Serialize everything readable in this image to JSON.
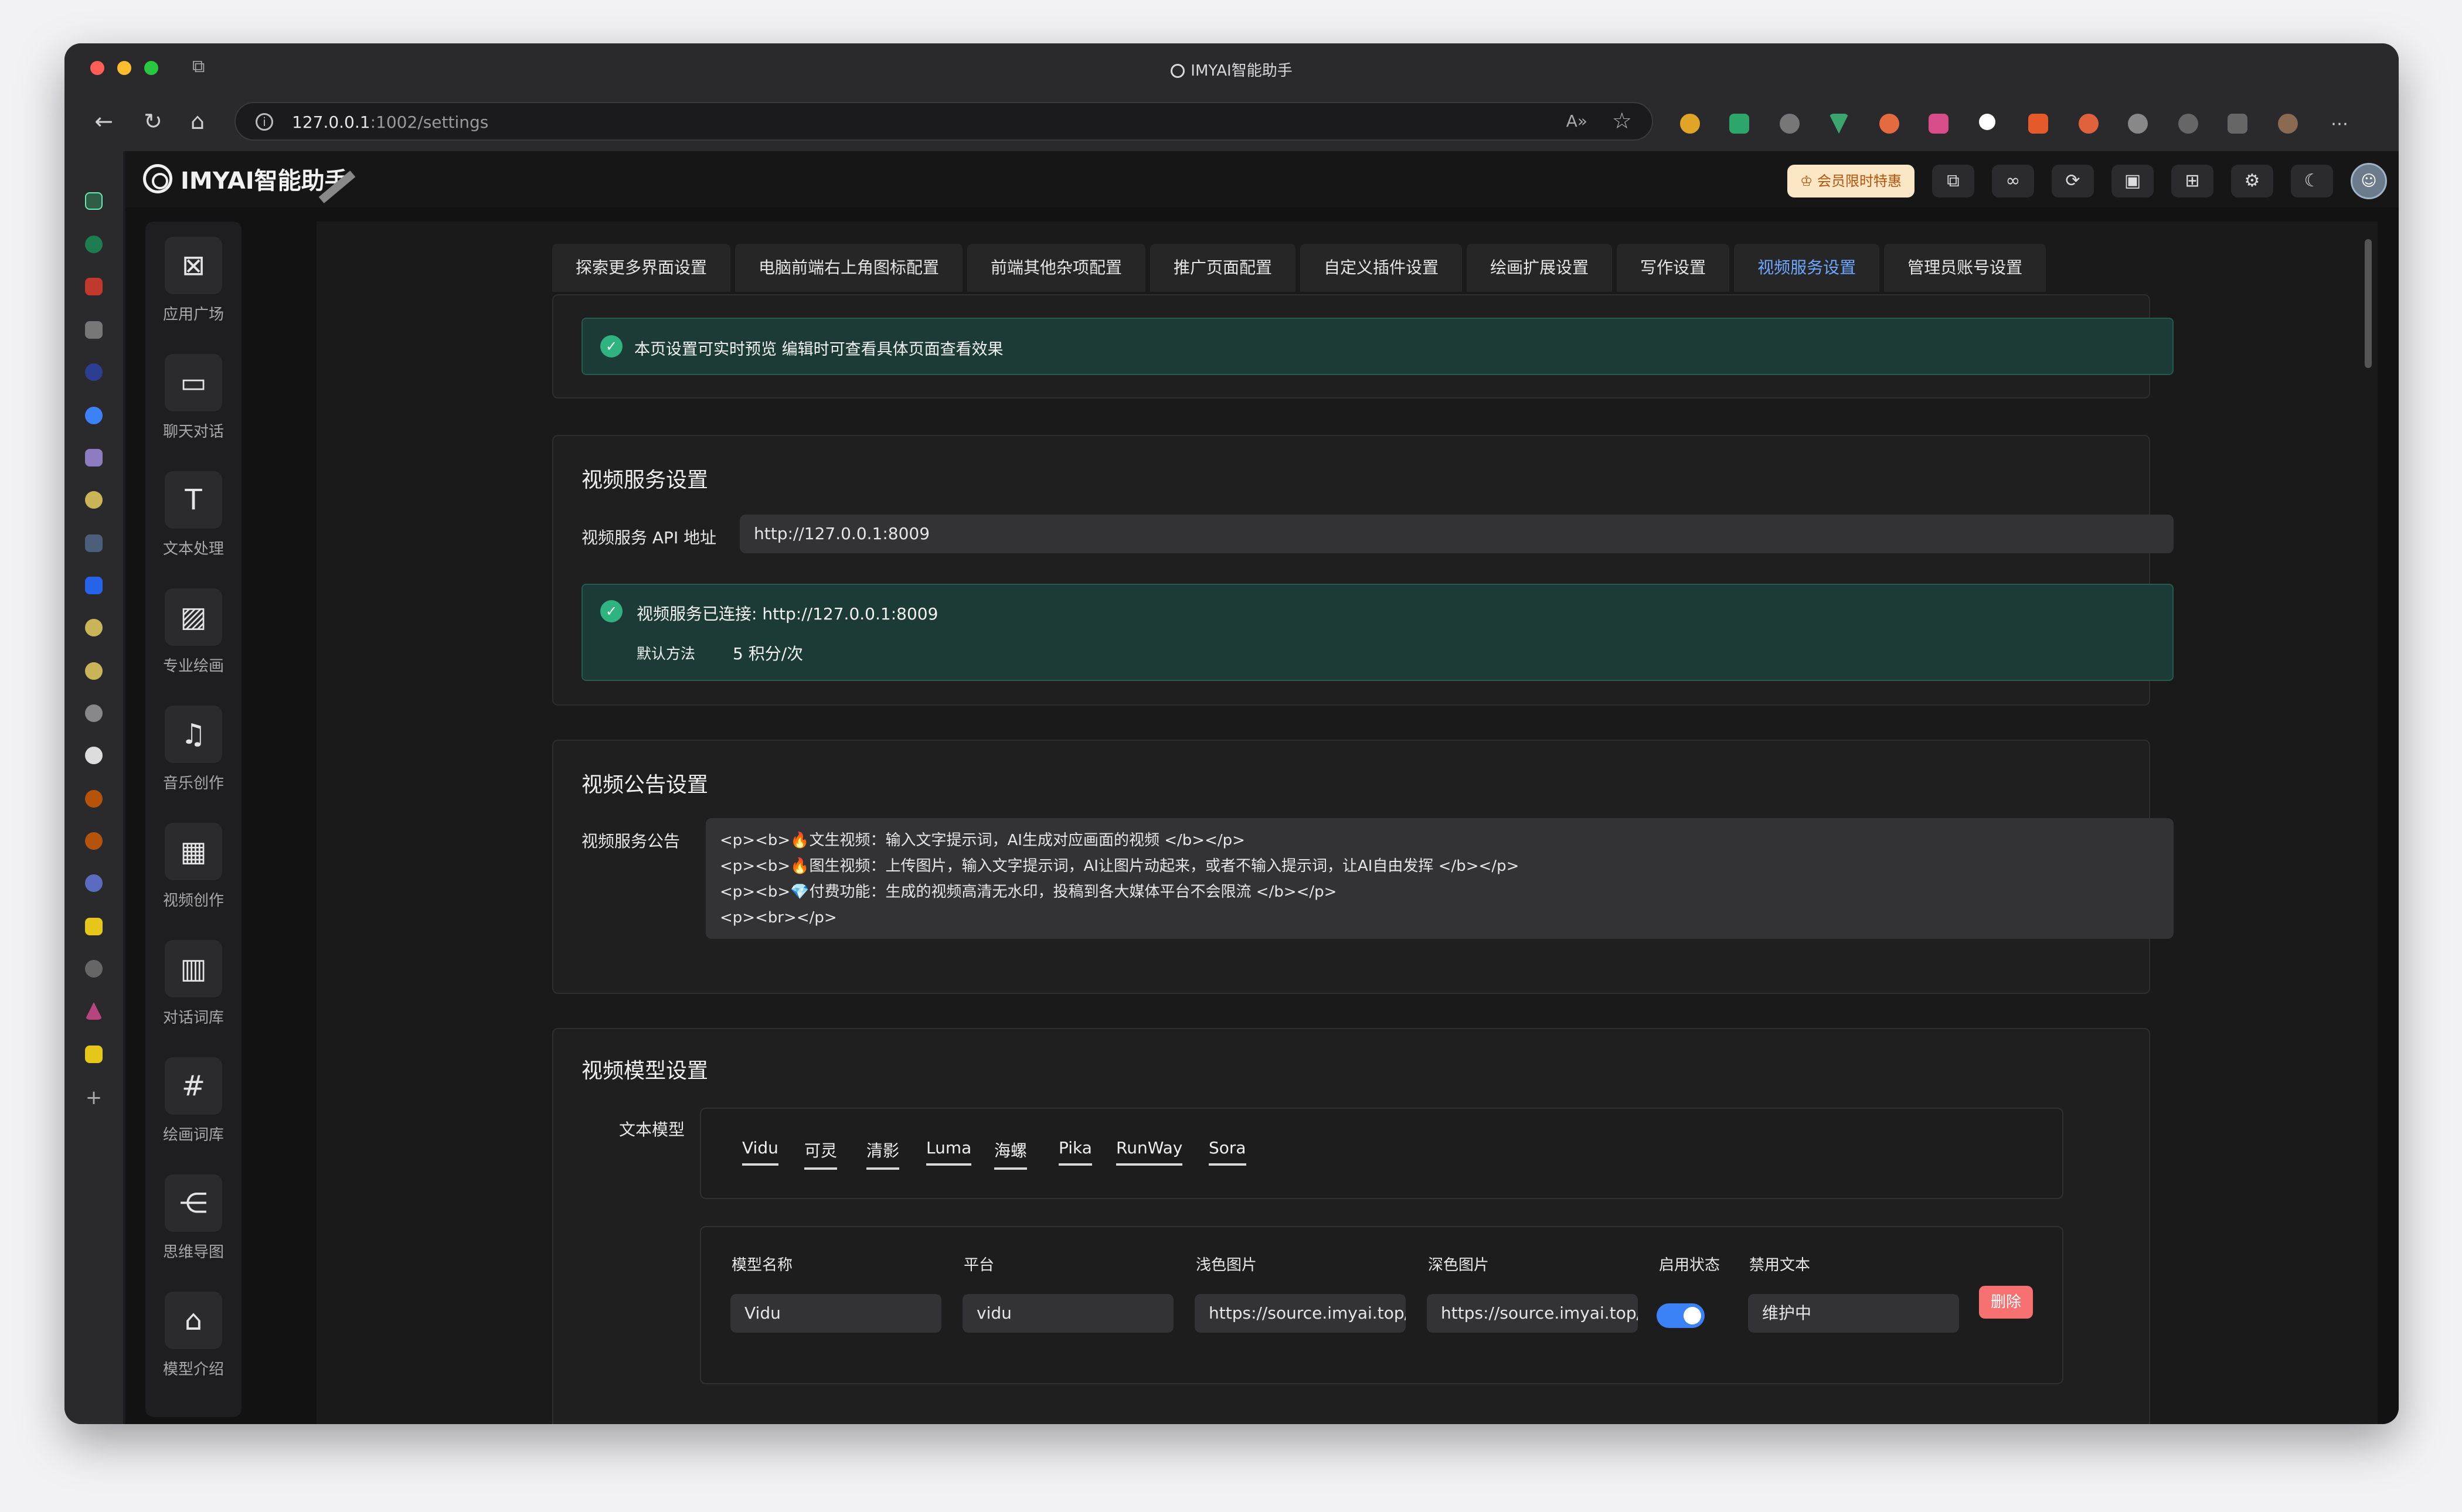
{
  "window": {
    "title": "IMYAI智能助手"
  },
  "browser": {
    "url_host": "127.0.0.1",
    "url_path": ":1002/settings"
  },
  "app": {
    "brand": "IMYAI智能助手",
    "vip_label": "会员限时特惠",
    "nav": [
      {
        "label": "应用广场",
        "icon": "app-store-icon"
      },
      {
        "label": "聊天对话",
        "icon": "chat-icon"
      },
      {
        "label": "文本处理",
        "icon": "text-icon"
      },
      {
        "label": "专业绘画",
        "icon": "image-icon"
      },
      {
        "label": "音乐创作",
        "icon": "music-icon"
      },
      {
        "label": "视频创作",
        "icon": "video-icon"
      },
      {
        "label": "对话词库",
        "icon": "book-icon"
      },
      {
        "label": "绘画词库",
        "icon": "palette-icon"
      },
      {
        "label": "思维导图",
        "icon": "mindmap-icon"
      },
      {
        "label": "模型介绍",
        "icon": "robot-icon"
      }
    ]
  },
  "settings": {
    "tabs": [
      "探索更多界面设置",
      "电脑前端右上角图标配置",
      "前端其他杂项配置",
      "推广页面配置",
      "自定义插件设置",
      "绘画扩展设置",
      "写作设置",
      "视频服务设置",
      "管理员账号设置"
    ],
    "active_tab": 7,
    "notice": "本页设置可实时预览 编辑时可查看具体页面查看效果",
    "service": {
      "title": "视频服务设置",
      "api_label": "视频服务 API 地址",
      "api_value": "http://127.0.0.1:8009",
      "status_text": "视频服务已连接: http://127.0.0.1:8009",
      "method_label": "默认方法",
      "method_value": "5 积分/次"
    },
    "announcement": {
      "title": "视频公告设置",
      "label": "视频服务公告",
      "lines": [
        "<p><b>🔥文生视频：输入文字提示词，AI生成对应画面的视频 </b></p>",
        "<p><b>🔥图生视频：上传图片，输入文字提示词，AI让图片动起来，或者不输入提示词，让AI自由发挥 </b></p>",
        "<p><b>💎付费功能：生成的视频高清无水印，投稿到各大媒体平台不会限流 </b></p>",
        "<p><br></p>"
      ]
    },
    "models": {
      "title": "视频模型设置",
      "label": "文本模型",
      "tabs": [
        "Vidu",
        "可灵",
        "清影",
        "Luma",
        "海螺",
        "Pika",
        "RunWay",
        "Sora"
      ],
      "columns": [
        "模型名称",
        "平台",
        "浅色图片",
        "深色图片",
        "启用状态",
        "禁用文本"
      ],
      "row": {
        "name": "Vidu",
        "platform": "vidu",
        "light_img": "https://source.imyai.top/",
        "dark_img": "https://source.imyai.top/",
        "enabled": true,
        "disabled_text": "维护中"
      },
      "delete_label": "删除"
    }
  }
}
